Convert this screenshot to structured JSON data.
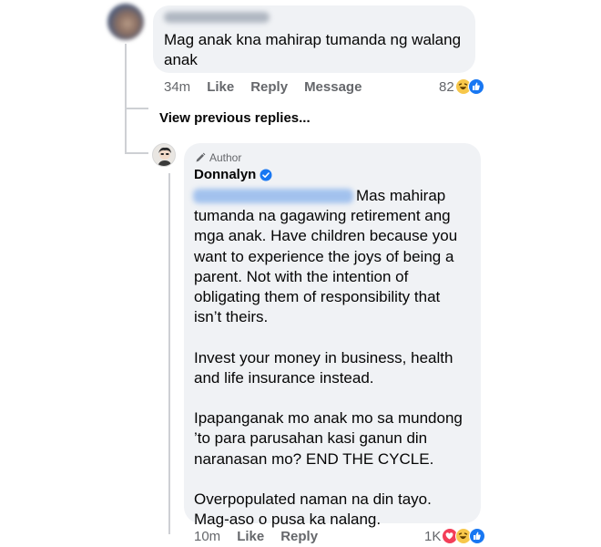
{
  "comment": {
    "text": "Mag anak kna mahirap tumanda ng walang anak",
    "time": "34m",
    "like_label": "Like",
    "reply_label": "Reply",
    "message_label": "Message",
    "reaction_count": "82",
    "reactions": [
      "haha",
      "like"
    ]
  },
  "view_previous_replies": "View previous replies...",
  "reply": {
    "author_badge": "Author",
    "author_name": "Donnalyn",
    "paragraphs": [
      [
        "Mas mahirap",
        "tumanda na gagawing retirement ang",
        "mga anak. Have children because you",
        "want to experience the joys of being a",
        "parent. Not with the intention of",
        "obligating them of responsibility that",
        "isn’t theirs."
      ],
      [
        "Invest your money in business, health",
        "and life insurance instead."
      ],
      [
        "Ipapanganak mo anak mo sa mundong",
        "’to para parusahan kasi ganun din",
        "naranasan mo? END THE CYCLE."
      ],
      [
        "Overpopulated naman na din tayo.",
        "Mag-aso o pusa ka nalang."
      ]
    ],
    "time": "10m",
    "like_label": "Like",
    "reply_label": "Reply",
    "reaction_count": "1K",
    "reactions": [
      "love",
      "haha",
      "like"
    ]
  },
  "colors": {
    "bubble": "#f0f2f5",
    "meta_text": "#65676b",
    "like_blue": "#1877f2",
    "love_red": "#f33e58",
    "haha_yellow": "#f7c74a"
  }
}
